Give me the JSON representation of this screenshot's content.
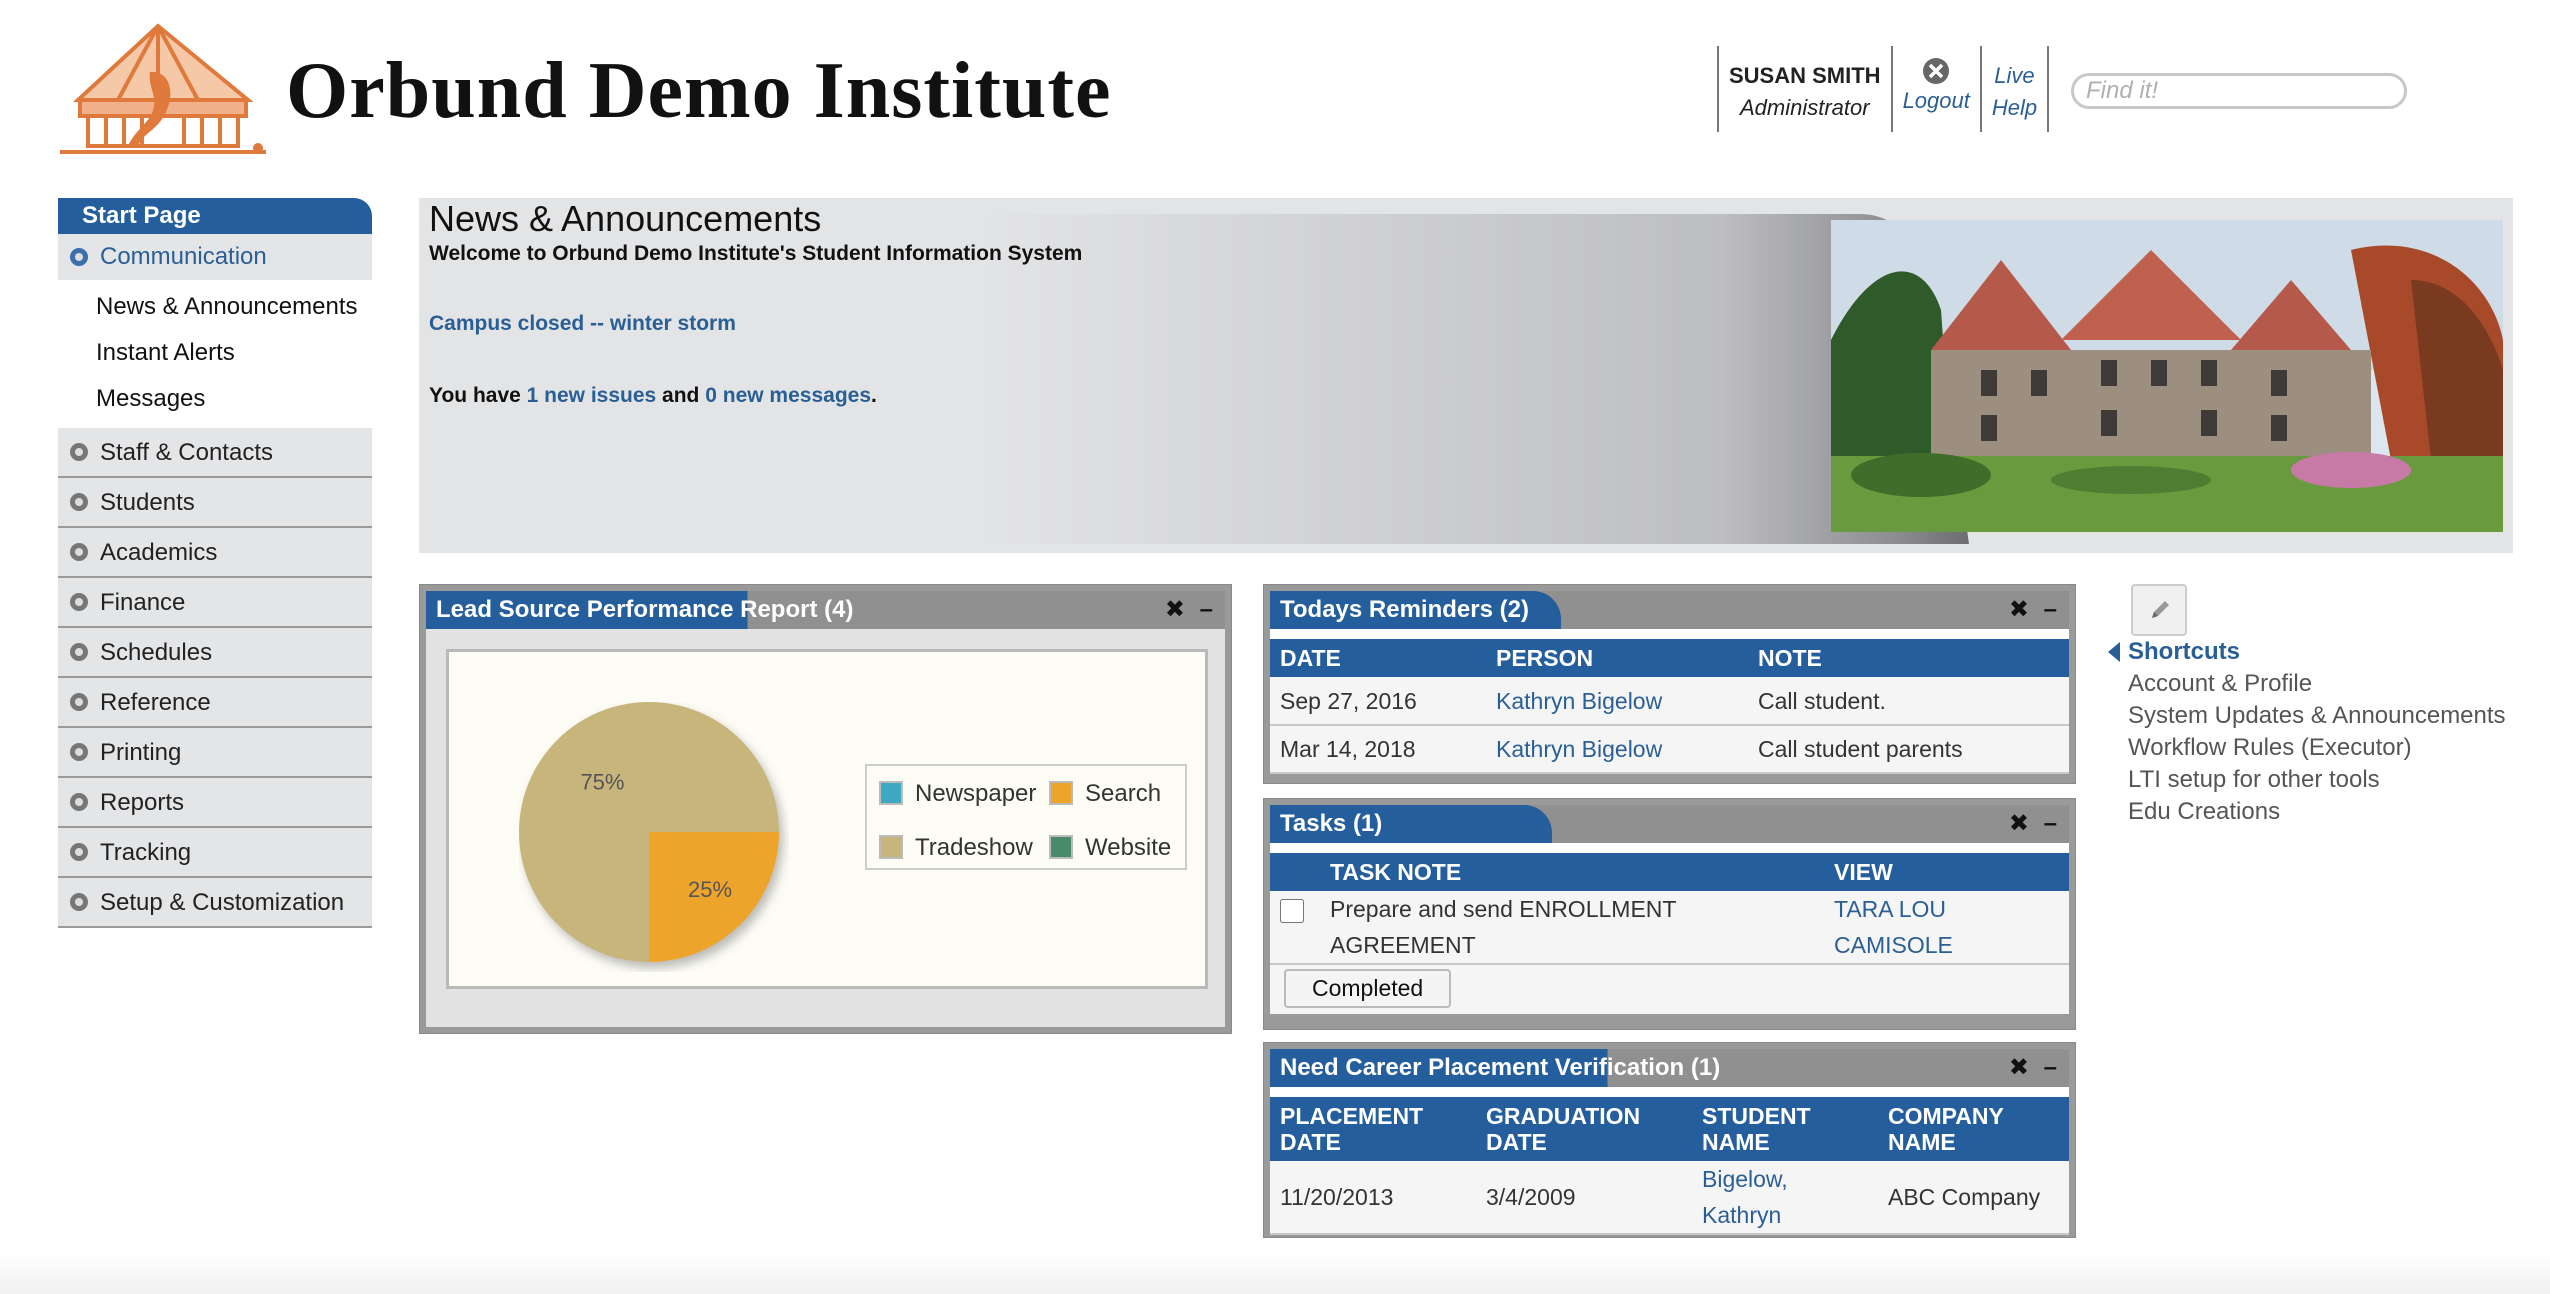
{
  "header": {
    "institute_name": "Orbund Demo Institute",
    "user_name": "SUSAN SMITH",
    "user_role": "Administrator",
    "logout_label": "Logout",
    "help_line1": "Live",
    "help_line2": "Help",
    "search_placeholder": "Find it!"
  },
  "nav": {
    "header": "Start Page",
    "open_group": "Communication",
    "sub_items": [
      "News & Announcements",
      "Instant Alerts",
      "Messages"
    ],
    "groups": [
      "Staff & Contacts",
      "Students",
      "Academics",
      "Finance",
      "Schedules",
      "Reference",
      "Printing",
      "Reports",
      "Tracking",
      "Setup & Customization"
    ]
  },
  "news": {
    "title": "News & Announcements",
    "welcome": "Welcome to Orbund Demo Institute's Student Information System",
    "announcement_link": "Campus closed -- winter storm",
    "issues_prefix": "You have ",
    "issues_link": "1 new issues",
    "issues_middle": " and ",
    "messages_link": "0 new messages",
    "issues_suffix": "."
  },
  "lead_widget": {
    "title": "Lead Source Performance Report (4)",
    "close": "✖",
    "minimize": "–"
  },
  "chart_data": {
    "type": "pie",
    "slices": [
      {
        "label": "Tradeshow",
        "value": 75,
        "color": "#c8b57c"
      },
      {
        "label": "Search",
        "value": 25,
        "color": "#eca42b"
      }
    ],
    "slice_labels": [
      "75%",
      "25%"
    ],
    "legend": [
      {
        "label": "Newspaper",
        "color": "#3fa9c4"
      },
      {
        "label": "Search",
        "color": "#eca42b"
      },
      {
        "label": "Tradeshow",
        "color": "#c8b57c"
      },
      {
        "label": "Website",
        "color": "#4a8a6a"
      }
    ]
  },
  "reminders": {
    "title": "Todays Reminders (2)",
    "close": "✖",
    "minimize": "–",
    "columns": [
      "DATE",
      "PERSON",
      "NOTE"
    ],
    "rows": [
      {
        "date": "Sep 27, 2016",
        "person": "Kathryn Bigelow",
        "note": "Call student."
      },
      {
        "date": "Mar 14, 2018",
        "person": "Kathryn Bigelow",
        "note": "Call student parents"
      }
    ]
  },
  "tasks": {
    "title": "Tasks (1)",
    "close": "✖",
    "minimize": "–",
    "columns": [
      "TASK NOTE",
      "VIEW"
    ],
    "rows": [
      {
        "note": "Prepare and send ENROLLMENT AGREEMENT",
        "view": "TARA LOU CAMISOLE",
        "checked": false
      }
    ],
    "completed_button": "Completed"
  },
  "placement": {
    "title": "Need Career Placement Verification (1)",
    "close": "✖",
    "minimize": "–",
    "columns": [
      "PLACEMENT DATE",
      "GRADUATION DATE",
      "STUDENT NAME",
      "COMPANY NAME"
    ],
    "rows": [
      {
        "placement_date": "11/20/2013",
        "graduation_date": "3/4/2009",
        "student": "Bigelow, Kathryn",
        "company": "ABC Company"
      }
    ]
  },
  "shortcuts": {
    "title": "Shortcuts",
    "items": [
      "Account & Profile",
      "System Updates & Announcements",
      "Workflow Rules (Executor)",
      "LTI setup for other tools",
      "Edu Creations"
    ]
  },
  "colors": {
    "brand_blue": "#255e9c",
    "link_blue": "#2a5f95",
    "logo_orange": "#e0793c"
  }
}
